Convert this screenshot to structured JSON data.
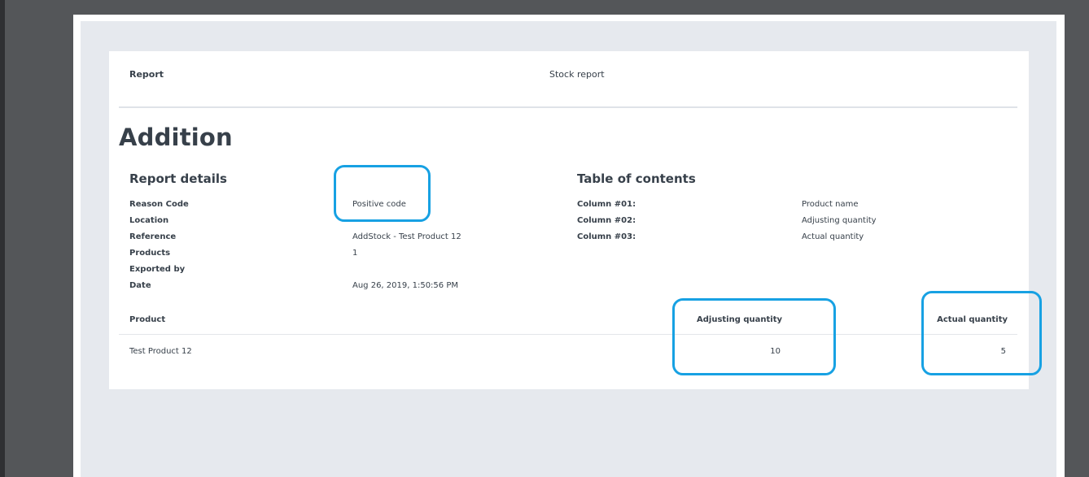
{
  "header": {
    "label": "Report",
    "title": "Stock report"
  },
  "main_title": "Addition",
  "details": {
    "title": "Report details",
    "rows": [
      {
        "label": "Reason Code",
        "value": "Positive code"
      },
      {
        "label": "Location",
        "value": ""
      },
      {
        "label": "Reference",
        "value": "AddStock - Test Product 12"
      },
      {
        "label": "Products",
        "value": "1"
      },
      {
        "label": "Exported by",
        "value": ""
      },
      {
        "label": "Date",
        "value": "Aug 26, 2019, 1:50:56 PM"
      }
    ]
  },
  "toc": {
    "title": "Table of contents",
    "rows": [
      {
        "label": "Column #01:",
        "value": "Product name"
      },
      {
        "label": "Column #02:",
        "value": "Adjusting quantity"
      },
      {
        "label": "Column #03:",
        "value": "Actual quantity"
      }
    ]
  },
  "table": {
    "headers": {
      "product": "Product",
      "adjusting": "Adjusting quantity",
      "actual": "Actual quantity"
    },
    "rows": [
      {
        "product": "Test Product 12",
        "adjusting": "10",
        "actual": "5"
      }
    ]
  },
  "colors": {
    "highlight": "#17a1e3",
    "text": "#37404a",
    "page_background": "#e6e9ee",
    "viewer_background": "#545659"
  }
}
